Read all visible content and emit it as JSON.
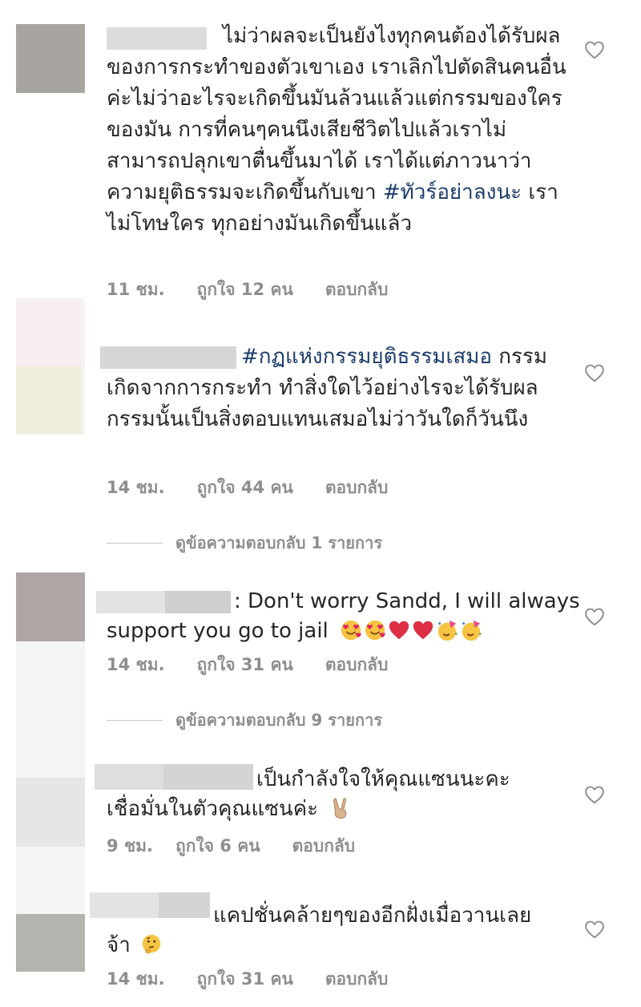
{
  "comments": [
    {
      "text_prefix": "ไม่ว่าผลจะเป็นยังไงทุกคนต้องได้รับผลของการกระทำของตัวเขาเอง เราเลิกไปตัดสินคนอื่นค่ะไม่ว่าอะไรจะเกิดขึ้นมันล้วนแล้วแต่กรรมของใครของมัน การที่คนๆคนนึงเสียชีวิตไปแล้วเราไม่สามารถปลุกเขาตื่นขึ้นมาได้ เราได้แต่ภาวนาว่าความยุติธรรมจะเกิดขึ้นกับเขา ",
      "hashtag": "#ทัวร์อย่าลงนะ",
      "text_suffix": " เราไม่โทษใคร ทุกอย่างมันเกิดขึ้นแล้ว",
      "time": "11 ชม.",
      "likes": "ถูกใจ 12 คน",
      "reply": "ตอบกลับ"
    },
    {
      "hashtag": "#กฏแห่งกรรมยุติธรรมเสมอ",
      "text_suffix": " กรรมเกิดจากการกระทำ ทำสิ่งใดไว้อย่างไรจะได้รับผลกรรมนั้นเป็นสิ่งตอบแทนเสมอไม่ว่าวันใดก็วันนึง",
      "time": "14 ชม.",
      "likes": "ถูกใจ 44 คน",
      "reply": "ตอบกลับ",
      "view_replies": "ดูข้อความตอบกลับ 1 รายการ"
    },
    {
      "text_line1": ": Don't worry Sandd, I will always",
      "text_line2": "support you go to jail",
      "emojis": [
        "smiling-face-with-hearts",
        "smiling-face-with-hearts",
        "red-heart",
        "red-heart",
        "partying-face",
        "partying-face"
      ],
      "time": "14 ชม.",
      "likes": "ถูกใจ 31 คน",
      "reply": "ตอบกลับ",
      "view_replies": "ดูข้อความตอบกลับ 9 รายการ"
    },
    {
      "text_line1": "เป็นกำลังใจให้คุณแซนนะคะ",
      "text_line2": "เชื่อมั่นในตัวคุณแซนค่ะ",
      "emojis": [
        "victory-hand"
      ],
      "time": "9 ชม.",
      "likes": "ถูกใจ 6 คน",
      "reply": "ตอบกลับ"
    },
    {
      "text_line1": "แคปชั่นคล้ายๆของอีกฝั่งเมื่อวานเลย",
      "text_line2": "จ้า",
      "emojis": [
        "thinking-face"
      ],
      "time": "14 ชม.",
      "likes": "ถูกใจ 31 คน",
      "reply": "ตอบกลับ"
    }
  ],
  "colors": {
    "text": "#262626",
    "meta": "#8e8e8e",
    "hashtag": "#1c3c6c",
    "heart": "#8e8e8e"
  },
  "icons": {
    "like": "heart-outline-icon"
  }
}
